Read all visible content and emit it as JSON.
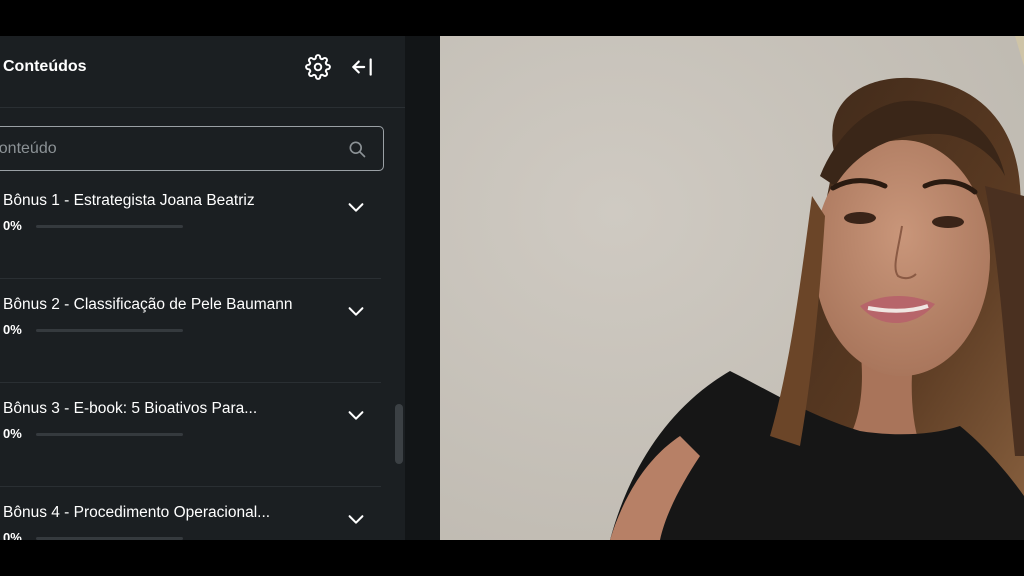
{
  "sidebar": {
    "title": "Conteúdos",
    "search_placeholder": "r conteúdo",
    "modules": [
      {
        "title": "Bônus 1 - Estrategista Joana Beatriz",
        "progress_label": "0%",
        "progress": 0
      },
      {
        "title": "Bônus 2 - Classificação de Pele Baumann",
        "progress_label": "0%",
        "progress": 0
      },
      {
        "title": "Bônus 3 - E-book: 5 Bioativos Para...",
        "progress_label": "0%",
        "progress": 0
      },
      {
        "title": "Bônus 4 - Procedimento Operacional...",
        "progress_label": "0%",
        "progress": 0
      }
    ]
  },
  "icons": {
    "settings": "gear-icon",
    "collapse": "collapse-sidebar-icon",
    "search": "search-icon",
    "expand": "chevron-down-icon"
  },
  "colors": {
    "sidebar_bg": "#1b1f22",
    "progress_fill": "#4caf7a",
    "video_wall": "#c9c4bb"
  }
}
